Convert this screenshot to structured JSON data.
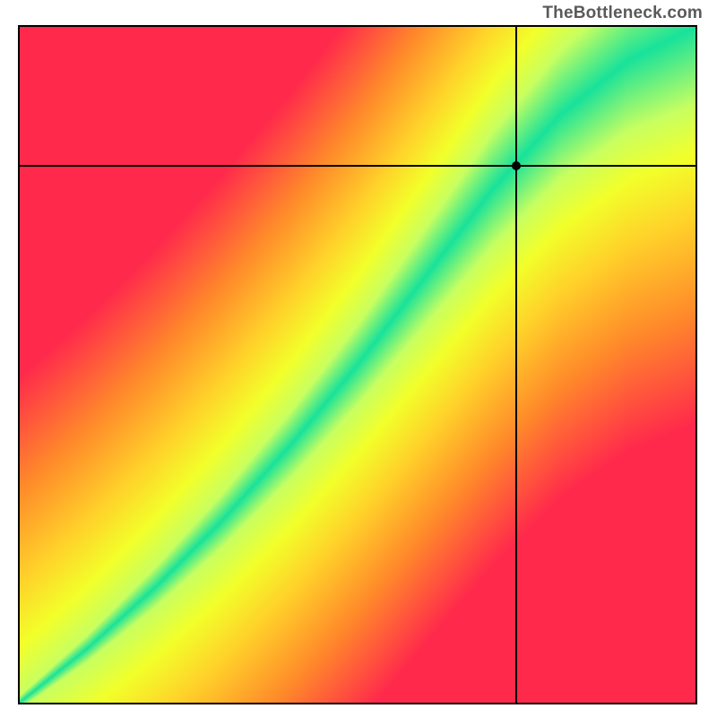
{
  "watermark": "TheBottleneck.com",
  "chart_data": {
    "type": "heatmap",
    "title": "",
    "xlabel": "",
    "ylabel": "",
    "xlim": [
      0,
      1
    ],
    "ylim": [
      0,
      1
    ],
    "grid": false,
    "legend": false,
    "marker": {
      "x": 0.735,
      "y": 0.795
    },
    "colorscale": [
      {
        "value": 0.0,
        "color": "#ff2a4b"
      },
      {
        "value": 0.3,
        "color": "#ff8a2a"
      },
      {
        "value": 0.55,
        "color": "#ffd22a"
      },
      {
        "value": 0.72,
        "color": "#f2ff2a"
      },
      {
        "value": 0.85,
        "color": "#c8ff60"
      },
      {
        "value": 1.0,
        "color": "#18e29a"
      }
    ],
    "ridge": {
      "description": "green optimal band running lower-left to upper-right, curving slightly",
      "points": [
        {
          "x": 0.0,
          "y": 0.0,
          "width": 0.01
        },
        {
          "x": 0.1,
          "y": 0.08,
          "width": 0.02
        },
        {
          "x": 0.2,
          "y": 0.17,
          "width": 0.03
        },
        {
          "x": 0.3,
          "y": 0.27,
          "width": 0.04
        },
        {
          "x": 0.4,
          "y": 0.38,
          "width": 0.05
        },
        {
          "x": 0.5,
          "y": 0.5,
          "width": 0.06
        },
        {
          "x": 0.6,
          "y": 0.63,
          "width": 0.072
        },
        {
          "x": 0.7,
          "y": 0.76,
          "width": 0.085
        },
        {
          "x": 0.8,
          "y": 0.87,
          "width": 0.095
        },
        {
          "x": 0.9,
          "y": 0.95,
          "width": 0.105
        },
        {
          "x": 1.0,
          "y": 1.0,
          "width": 0.115
        }
      ]
    }
  }
}
